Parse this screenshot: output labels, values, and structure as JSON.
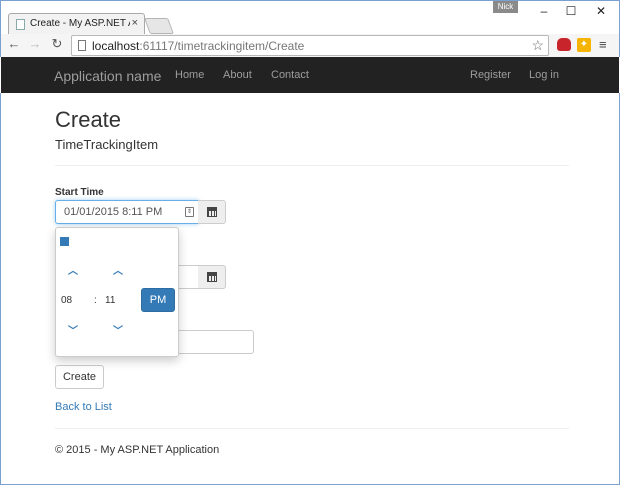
{
  "browser": {
    "tab_title": "Create - My ASP.NET Application",
    "tab_close": "×",
    "user_badge": "Nick",
    "url_host": "localhost",
    "url_path": ":61117/timetrackingitem/Create",
    "window_controls": [
      "–",
      "☐",
      "✕"
    ],
    "icons": [
      "back-arrow-icon",
      "forward-arrow-icon",
      "reload-icon",
      "star-icon",
      "menu-icon"
    ]
  },
  "navbar": {
    "brand": "Application name",
    "links": [
      "Home",
      "About",
      "Contact"
    ],
    "right_links": [
      "Register",
      "Log in"
    ],
    "bg_color": "#222222"
  },
  "page": {
    "title": "Create",
    "subtitle": "TimeTrackingItem",
    "start_time_label": "Start Time",
    "start_time_value": "01/01/2015 8:11 PM",
    "create_button": "Create",
    "back_link": "Back to List",
    "footer": "© 2015 - My ASP.NET Application"
  },
  "picker": {
    "hour": "08",
    "separator": ":",
    "minute": "11",
    "period": "PM",
    "accent_color": "#337ab7"
  }
}
